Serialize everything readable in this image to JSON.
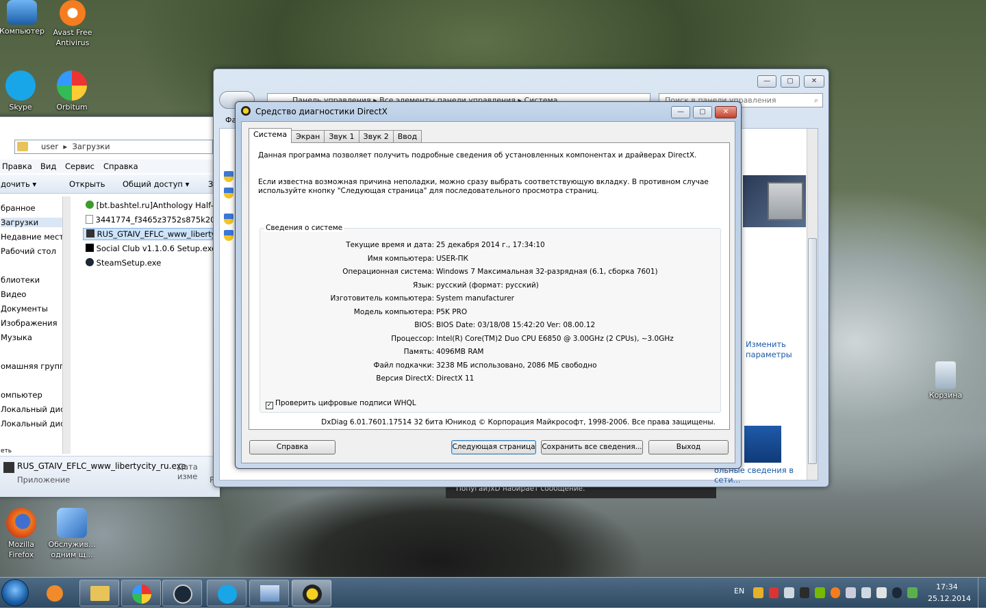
{
  "desktop": {
    "icons": [
      {
        "label": "Компьютер"
      },
      {
        "label": "Avast Free Antivirus"
      },
      {
        "label": "Skype"
      },
      {
        "label": "Orbitum"
      },
      {
        "label": "Mozilla Firefox"
      },
      {
        "label": "Обслужив... одним щ..."
      },
      {
        "label": "Корзина"
      }
    ]
  },
  "explorer": {
    "path": [
      "user",
      "Загрузки"
    ],
    "menu": [
      "Правка",
      "Вид",
      "Сервис",
      "Справка"
    ],
    "toolbar": [
      "дочить ▾",
      "Открыть",
      "Общий доступ ▾",
      "З"
    ],
    "nav": [
      "бранное",
      "Загрузки",
      "Недавние места",
      "Рабочий стол",
      "блиотеки",
      "Видео",
      "Документы",
      "Изображения",
      "Музыка",
      "омашняя группа",
      "омпьютер",
      "Локальный диск",
      "Локальный диск",
      "еть"
    ],
    "files": [
      "[bt.bashtel.ru]Anthology Half-Li",
      "3441774_f3465z3752s875k2002r6",
      "RUS_GTAIV_EFLC_www_libertyci",
      "Social Club v1.1.0.6 Setup.exe",
      "SteamSetup.exe"
    ],
    "details_name": "RUS_GTAIV_EFLC_www_libertycity_ru.exe",
    "details_date_label": "Дата изме",
    "details_type": "Приложение",
    "details_extra": "Р"
  },
  "control_panel": {
    "address": "Панель управления  ▸  Все элементы панели управления  ▸  Система",
    "search_placeholder": "Поиск в панели управления",
    "links": [
      "Изменить",
      "параметры",
      "ольные сведения в сети..."
    ],
    "fa_text": "Фа"
  },
  "chat": {
    "typing": "Попугай)xD набирает сообщение."
  },
  "dxdiag": {
    "title": "Средство диагностики DirectX",
    "tabs": [
      "Система",
      "Экран",
      "Звук 1",
      "Звук 2",
      "Ввод"
    ],
    "intro1": "Данная программа позволяет получить подробные сведения об установленных компонентах и драйверах DirectX.",
    "intro2": "Если известна возможная причина неполадки, можно сразу выбрать соответствующую вкладку. В противном случае используйте кнопку \"Следующая страница\" для последовательного просмотра страниц.",
    "group_title": "Сведения о системе",
    "rows": [
      {
        "k": "Текущие время и дата:",
        "v": "25 декабря 2014 г., 17:34:10"
      },
      {
        "k": "Имя компьютера:",
        "v": "USER-ПК"
      },
      {
        "k": "Операционная система:",
        "v": "Windows 7 Максимальная 32-разрядная (6.1, сборка 7601)"
      },
      {
        "k": "Язык:",
        "v": "русский (формат: русский)"
      },
      {
        "k": "Изготовитель компьютера:",
        "v": "System manufacturer"
      },
      {
        "k": "Модель компьютера:",
        "v": "P5K PRO"
      },
      {
        "k": "BIOS:",
        "v": "BIOS Date: 03/18/08 15:42:20 Ver: 08.00.12"
      },
      {
        "k": "Процессор:",
        "v": "Intel(R) Core(TM)2 Duo CPU     E6850  @ 3.00GHz (2 CPUs), ~3.0GHz"
      },
      {
        "k": "Память:",
        "v": "4096MB RAM"
      },
      {
        "k": "Файл подкачки:",
        "v": "3238 МБ использовано, 2086 МБ свободно"
      },
      {
        "k": "Версия DirectX:",
        "v": "DirectX 11"
      }
    ],
    "whql_label": "Проверить цифровые подписи WHQL",
    "whql_checked": true,
    "footer": "DxDiag 6.01.7601.17514 32 бита Юникод  © Корпорация Майкрософт, 1998-2006.  Все права защищены.",
    "buttons": {
      "help": "Справка",
      "next": "Следующая страница",
      "save": "Сохранить все сведения...",
      "exit": "Выход"
    }
  },
  "taskbar": {
    "lang": "EN",
    "time": "17:34",
    "date": "25.12.2014"
  }
}
